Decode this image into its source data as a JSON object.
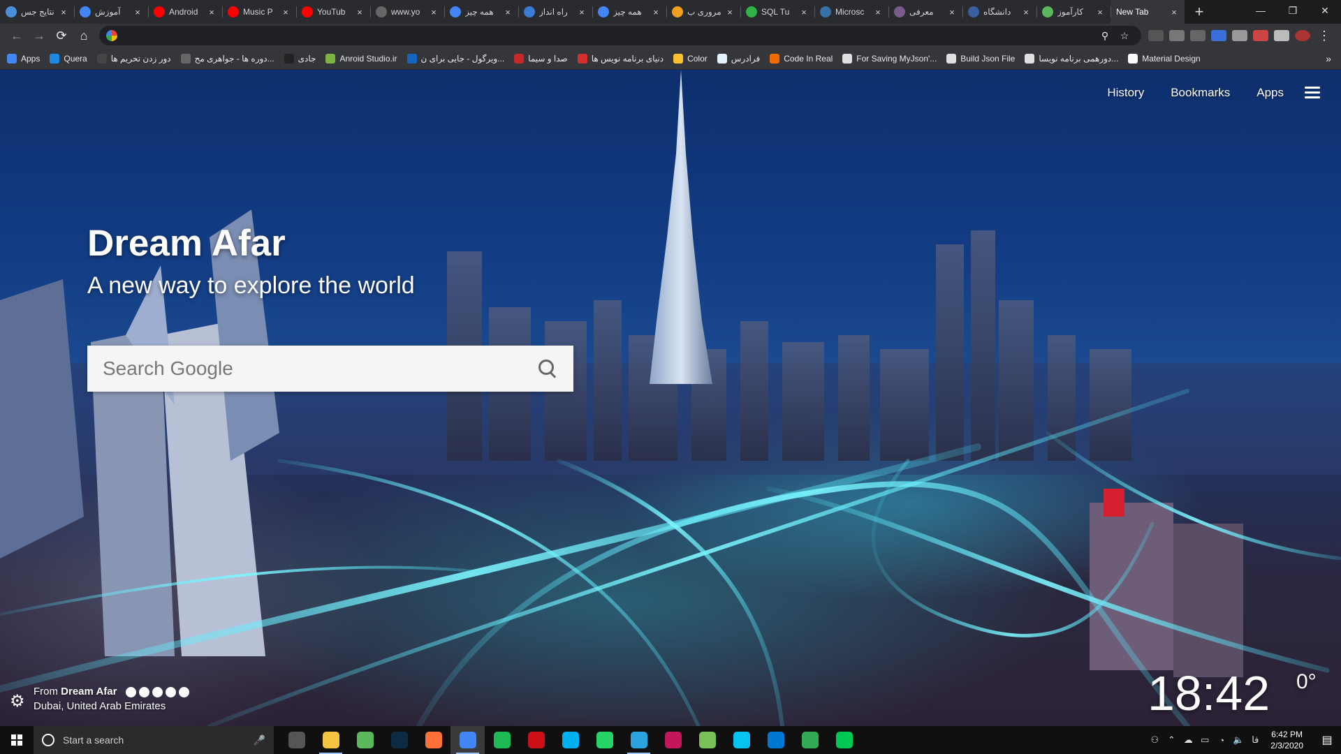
{
  "tabs": [
    {
      "title": "نتایج جس",
      "color": "#4a90d9"
    },
    {
      "title": "آموزش",
      "color": "#4285f4"
    },
    {
      "title": "Android",
      "color": "#ff0000"
    },
    {
      "title": "Music P",
      "color": "#ff0000"
    },
    {
      "title": "YouTub",
      "color": "#ff0000"
    },
    {
      "title": "www.yo",
      "color": "#666666"
    },
    {
      "title": "همه چیز",
      "color": "#4285f4"
    },
    {
      "title": "راه انداز",
      "color": "#3a7bd5"
    },
    {
      "title": "همه چیز",
      "color": "#4285f4"
    },
    {
      "title": "مروری ب",
      "color": "#f0a020"
    },
    {
      "title": "SQL Tu",
      "color": "#2fb344"
    },
    {
      "title": "Microsc",
      "color": "#3572a5"
    },
    {
      "title": "معرفی",
      "color": "#7a5c8c"
    },
    {
      "title": "دانشگاه",
      "color": "#3a5fa0"
    },
    {
      "title": "کارآموز",
      "color": "#5cb85c"
    },
    {
      "title": "New Tab",
      "color": "#35363a",
      "active": true
    }
  ],
  "close_glyph": "×",
  "newtab_glyph": "+",
  "window_controls": {
    "minimize": "—",
    "maximize": "❐",
    "close": "✕"
  },
  "toolbar": {
    "back": "←",
    "forward": "→",
    "reload": "⟳",
    "home": "⌂",
    "zoom_icon": "⚲",
    "star_icon": "☆",
    "menu_icon": "⋮"
  },
  "bookmarks": [
    {
      "label": "Apps",
      "color": "#4285f4"
    },
    {
      "label": "Quera",
      "color": "#1e88e5"
    },
    {
      "label": "دور زدن تحریم ها",
      "color": "#444444"
    },
    {
      "label": "دوره ها - جواهری مح...",
      "color": "#666666"
    },
    {
      "label": "جادی",
      "color": "#222222"
    },
    {
      "label": "Anroid Studio.ir",
      "color": "#7cb342"
    },
    {
      "label": "ویرگول - جایی برای ن...",
      "color": "#1565c0"
    },
    {
      "label": "صدا و سیما",
      "color": "#c62828"
    },
    {
      "label": "دنیای برنامه نویس ها",
      "color": "#d32f2f"
    },
    {
      "label": "Color",
      "color": "#fbc02d"
    },
    {
      "label": "فرادرس",
      "color": "#e3f2fd"
    },
    {
      "label": "Code In Real",
      "color": "#ef6c00"
    },
    {
      "label": "For Saving MyJson'...",
      "color": "#e0e0e0"
    },
    {
      "label": "Build Json File",
      "color": "#e0e0e0"
    },
    {
      "label": "دورهمی برنامه نویسا...",
      "color": "#e0e0e0"
    },
    {
      "label": "Material Design",
      "color": "#fafafa"
    }
  ],
  "bookmarks_more": "»",
  "newtab": {
    "nav": {
      "history": "History",
      "bookmarks": "Bookmarks",
      "apps": "Apps"
    },
    "title": "Dream Afar",
    "subtitle": "A new way to explore the world",
    "search_placeholder": "Search Google",
    "credit_from": "From",
    "credit_brand": "Dream Afar",
    "location": "Dubai, United Arab Emirates",
    "settings_icon": "⚙",
    "clock": "18:42",
    "temperature": "0°"
  },
  "taskbar": {
    "search_placeholder": "Start a search",
    "mic_icon": "🎤",
    "apps": [
      {
        "name": "task-view",
        "color": "#555555"
      },
      {
        "name": "file-explorer",
        "color": "#f4c542",
        "running": true
      },
      {
        "name": "telegram-green",
        "color": "#5cb85c"
      },
      {
        "name": "photoshop",
        "color": "#0c2a44"
      },
      {
        "name": "firefox",
        "color": "#ff7139"
      },
      {
        "name": "chrome",
        "color": "#4285f4",
        "active": true,
        "running": true
      },
      {
        "name": "spotify",
        "color": "#1db954"
      },
      {
        "name": "opera",
        "color": "#cc0f16"
      },
      {
        "name": "skype",
        "color": "#00aff0"
      },
      {
        "name": "whatsapp",
        "color": "#25d366"
      },
      {
        "name": "telegram",
        "color": "#2aa3de",
        "running": true
      },
      {
        "name": "intellij",
        "color": "#c2185b"
      },
      {
        "name": "android-studio",
        "color": "#78c257"
      },
      {
        "name": "webstorm",
        "color": "#07c3f2"
      },
      {
        "name": "vscode",
        "color": "#0078d4"
      },
      {
        "name": "chrome-dev",
        "color": "#34a853"
      },
      {
        "name": "mint-app",
        "color": "#00c853"
      }
    ],
    "tray": {
      "language": "فا",
      "time": "6:42 PM",
      "date": "2/3/2020"
    }
  }
}
